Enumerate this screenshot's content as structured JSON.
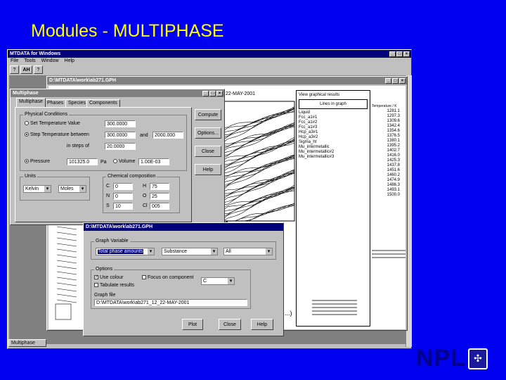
{
  "slide": {
    "title": "Modules - MULTIPHASE",
    "logo_text": "NPL"
  },
  "colors": {
    "slide_background": "#0000f0",
    "title_color": "#ffff00",
    "titlebar_active": "#00007b",
    "titlebar_inactive": "#808080",
    "window_face": "#c0c0c0"
  },
  "app": {
    "title": "MTDATA for Windows",
    "menu": [
      "File",
      "Tools",
      "Window",
      "Help"
    ],
    "toolbar": [
      "?",
      "AH",
      "?"
    ]
  },
  "graph_window": {
    "title": "D:\\MTDATA\\work\\ab271.GPH",
    "date_text": "22-MAY-2001",
    "list_header": "View graphical results",
    "list_box_title": "Lines in graph",
    "list_items": [
      "Liquid",
      "Fcc_a1#1",
      "Fcc_a1#2",
      "Fcc_a1#3",
      "Hcp_a3#1",
      "Hcp_a3#2",
      "Sigma_ht",
      "Mu_intermetallic",
      "Mu_intermetallic#2",
      "Mu_intermetallic#3"
    ],
    "right_header": "Temperature / K",
    "right_values": [
      "1281.1",
      "1297.3",
      "1309.6",
      "1342.4",
      "1354.6",
      "1376.5",
      "1380.1",
      "1395.2",
      "1402.7",
      "1416.0",
      "1425.3",
      "1437.8",
      "1451.6",
      "1460.2",
      "1474.9",
      "1486.3",
      "1493.1",
      "1500.0"
    ]
  },
  "multiphase_dialog": {
    "title": "Multiphase",
    "tabs": [
      "Multiphase",
      "Phases",
      "Species",
      "Components"
    ],
    "physical_group_label": "Physical Conditions",
    "set_temp_label": "Set Temperature Value",
    "set_temp_value": "300.0000",
    "step_label": "Step Temperature between",
    "step_from": "300.0000",
    "and_label": "and",
    "step_to": "2000.000",
    "increment_label": "in steps of",
    "increment_value": "20.0000",
    "pressure_label": "Pressure",
    "pressure_value": "101325.0",
    "pressure_unit": "Pa",
    "volume_label": "Volume",
    "volume_value": "1.00E-03",
    "units_group_label": "Units",
    "units_temp": "Kelvin",
    "units_amount": "Moles",
    "composition_group_label": "Chemical composition",
    "elements": [
      {
        "el": "C",
        "val": "0"
      },
      {
        "el": "H",
        "val": "75"
      },
      {
        "el": "N",
        "val": "0"
      },
      {
        "el": "O",
        "val": "25"
      },
      {
        "el": "S",
        "val": "10"
      },
      {
        "el": "Cl",
        "val": "005"
      }
    ],
    "buttons": [
      "Compute",
      "Options...",
      "Close",
      "Help"
    ]
  },
  "graph_dialog": {
    "title": "D:\\MTDATA\\work\\ab271.GPH",
    "axis_group_label": "Graph Variable",
    "variable_value": "Total phase amounts",
    "substance_value": "Substance",
    "all_value": "All",
    "options_group_label": "Options",
    "use_colour_label": "Use colour",
    "focus_label": "Focus on component",
    "focus_value": "C",
    "tabulate_label": "Tabulate results",
    "graph_file_label": "Graph file",
    "graph_file_value": "D:\\MTDATA\\work\\ab271_12_22-MAY-2001",
    "buttons": [
      "Plot",
      "Close",
      "Help"
    ]
  },
  "taskbar": {
    "item": "Multiphase"
  }
}
